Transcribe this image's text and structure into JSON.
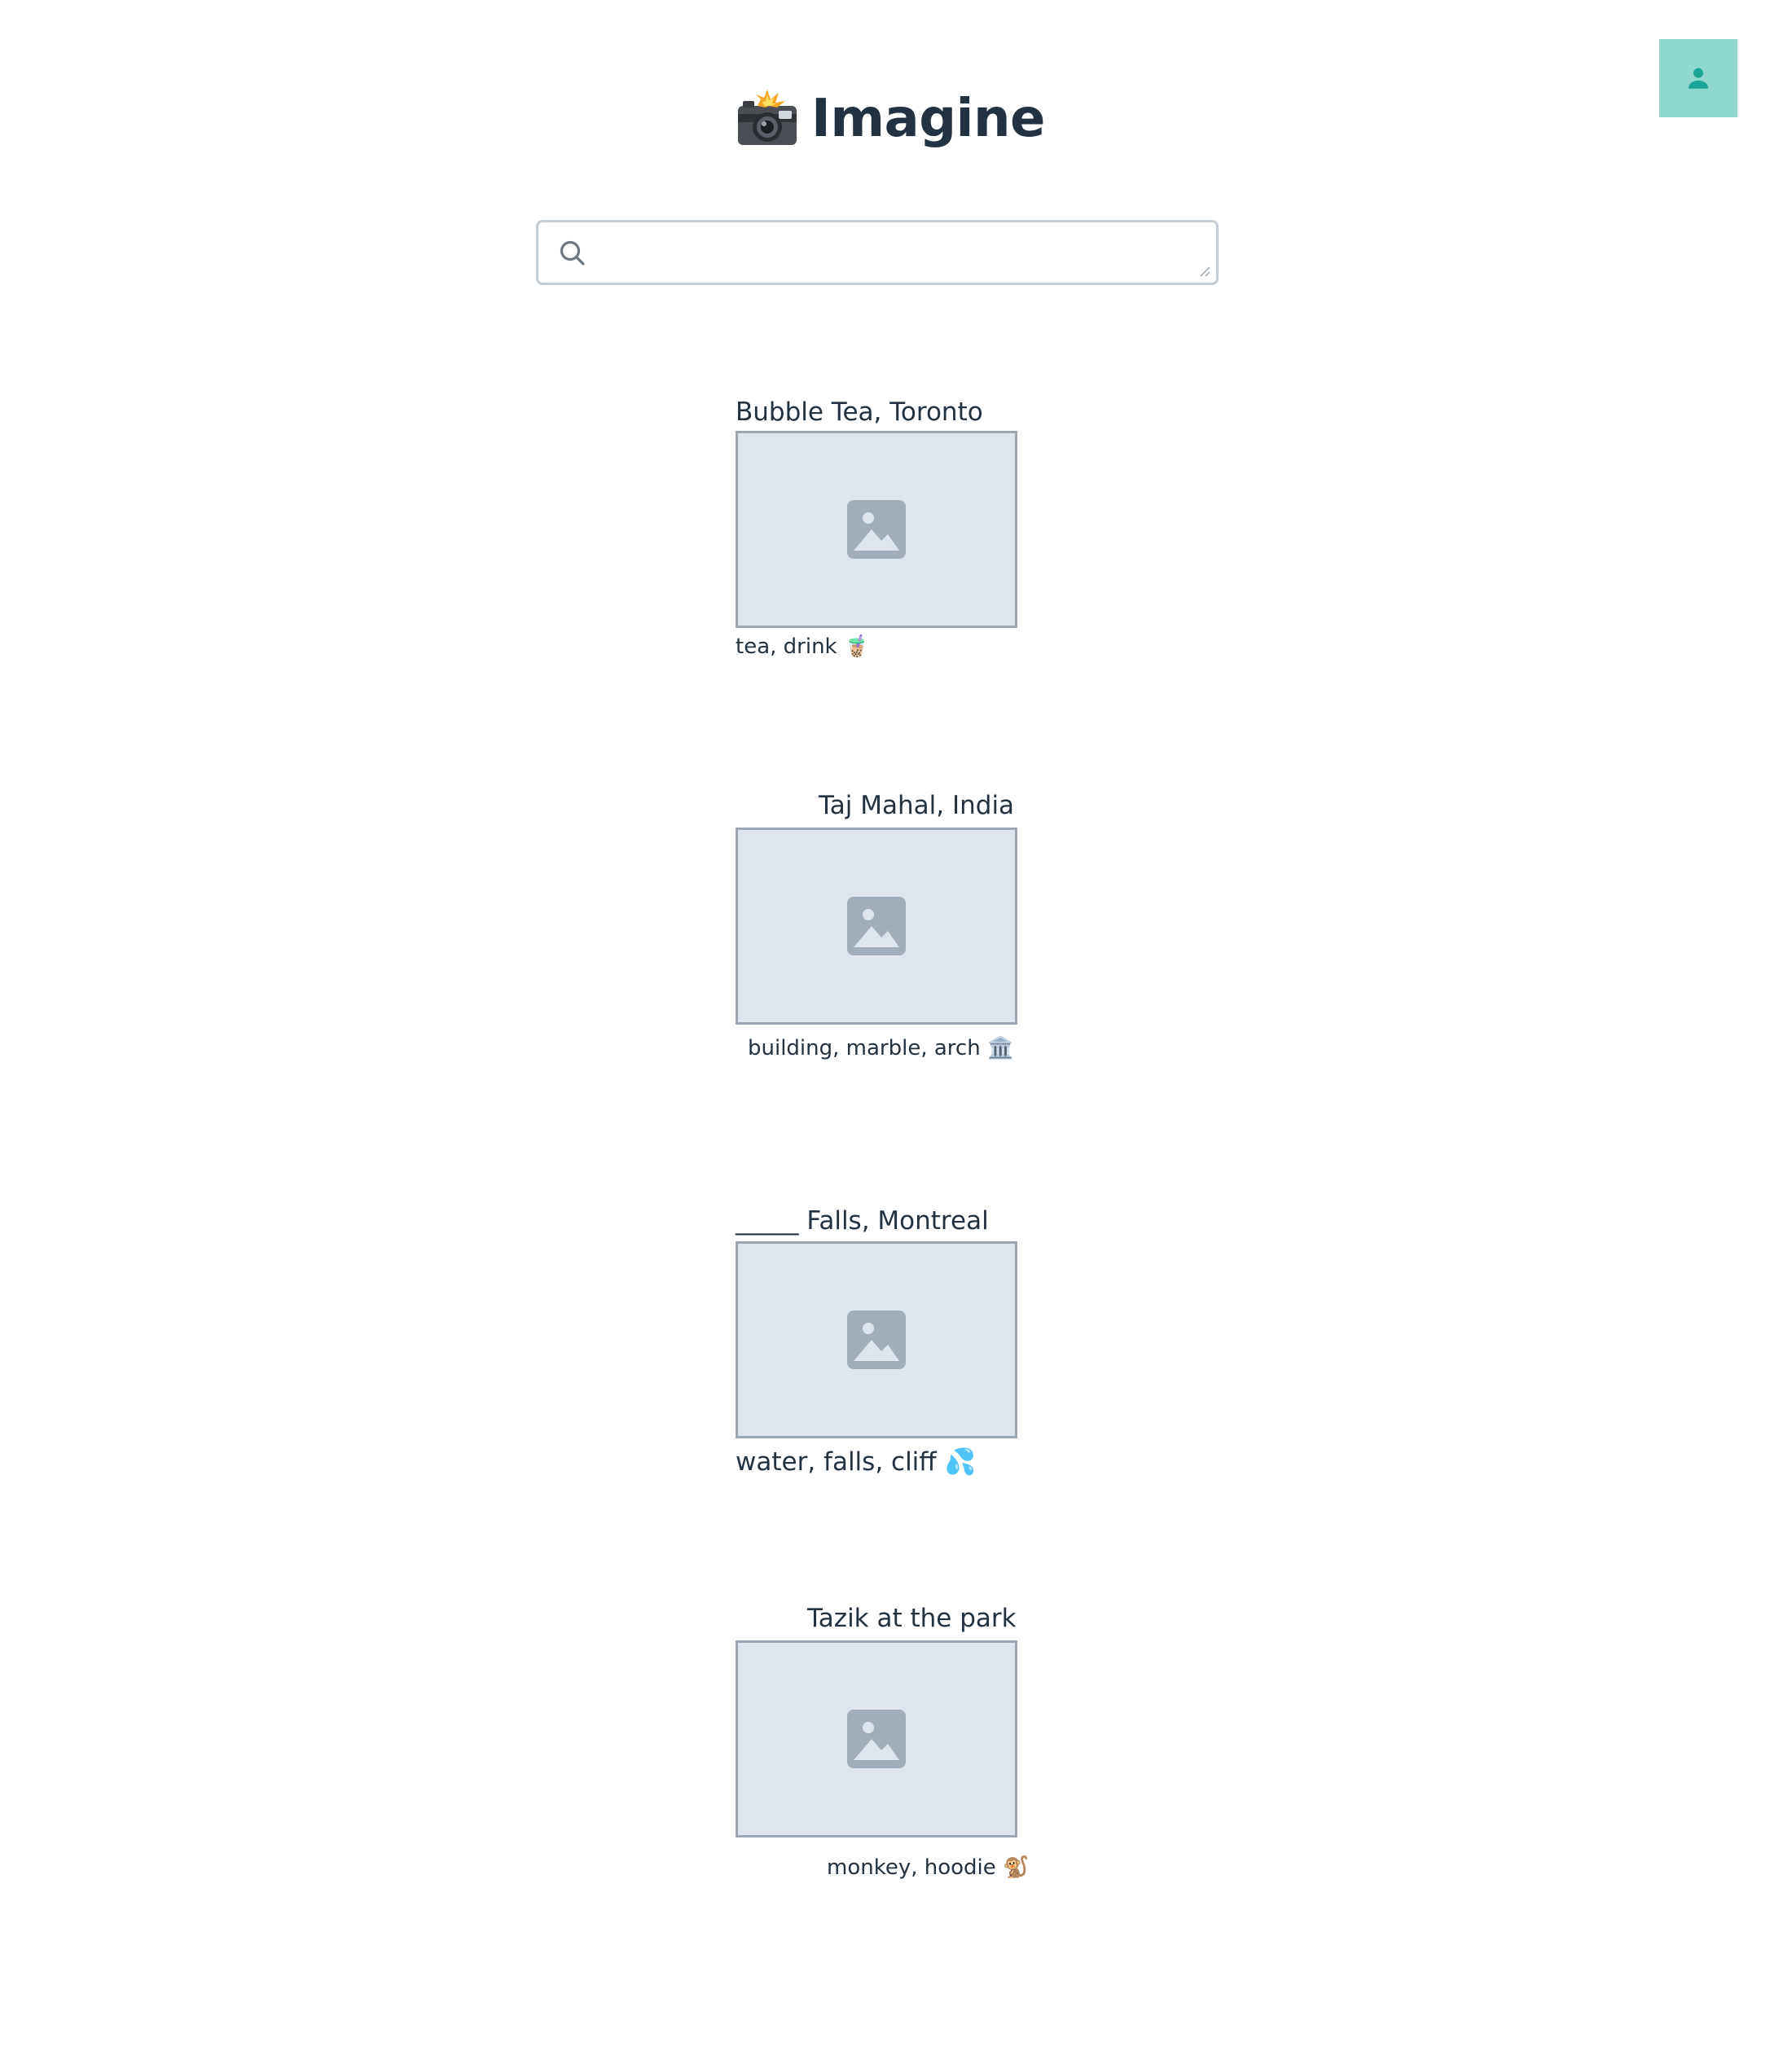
{
  "app": {
    "title": "Imagine",
    "title_emoji": "📸"
  },
  "header": {
    "user_button_icon": "user-icon"
  },
  "search": {
    "value": "",
    "placeholder": "",
    "icon": "search-icon"
  },
  "posts": [
    {
      "title": "Bubble Tea, Toronto",
      "image_icon": "image-placeholder-icon",
      "tags": "tea, drink 🧋"
    },
    {
      "title": "Taj Mahal, India",
      "image_icon": "image-placeholder-icon",
      "tags": "building, marble, arch 🏛️"
    },
    {
      "title": "_____ Falls, Montreal",
      "image_icon": "image-placeholder-icon",
      "tags": "water, falls, cliff 💦"
    },
    {
      "title": "Tazik at the park",
      "image_icon": "image-placeholder-icon",
      "tags": "monkey, hoodie 🐒"
    }
  ],
  "colors": {
    "accent": "#8ed8cd",
    "accent_icon": "#1aa596",
    "text": "#223240",
    "image_bg": "#dfe5ec",
    "image_border": "#9aa7b3",
    "input_border": "#c3cbd3"
  }
}
